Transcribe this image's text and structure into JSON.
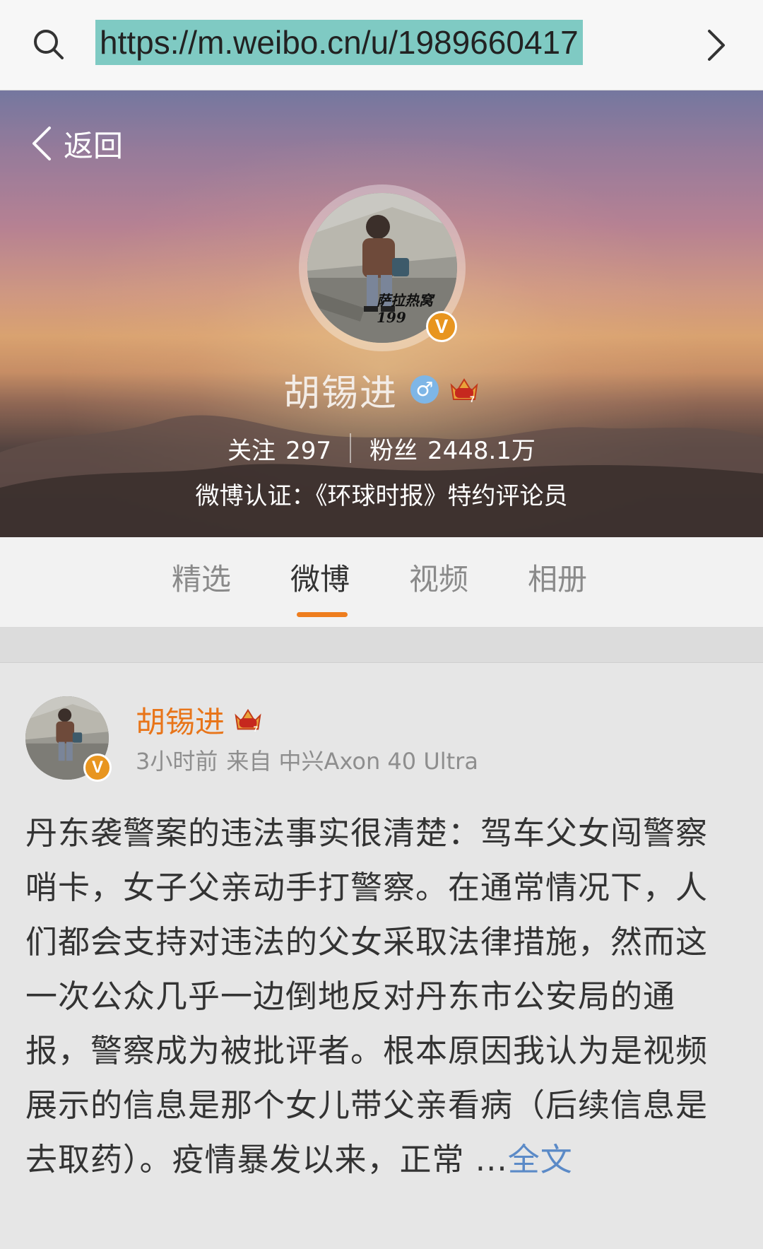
{
  "browser": {
    "url": "https://m.weibo.cn/u/1989660417",
    "search_icon": "search-icon",
    "forward_icon": "chevron-right-icon"
  },
  "header": {
    "back_label": "返回",
    "user_name": "胡锡进",
    "gender_symbol": "♂",
    "avatar_caption": "萨拉热窝 199",
    "verified_badge": "V",
    "follow_label": "关注",
    "follow_count": "297",
    "fans_label": "粉丝",
    "fans_count": "2448.1万",
    "verification": "微博认证：《环球时报》特约评论员"
  },
  "tabs": [
    {
      "label": "精选",
      "active": false
    },
    {
      "label": "微博",
      "active": true
    },
    {
      "label": "视频",
      "active": false
    },
    {
      "label": "相册",
      "active": false
    }
  ],
  "post": {
    "author": "胡锡进",
    "time": "3小时前",
    "source": "来自 中兴Axon 40 Ultra",
    "text": "丹东袭警案的违法事实很清楚：驾车父女闯警察哨卡，女子父亲动手打警察。在通常情况下，人们都会支持对违法的父女采取法律措施，然而这一次公众几乎一边倒地反对丹东市公安局的通报，警察成为被批评者。根本原因我认为是视频展示的信息是那个女儿带父亲看病（后续信息是去取药）。疫情暴发以来，正常 ...",
    "more_label": "全文"
  },
  "colors": {
    "accent": "#ee7d1e",
    "username": "#e8751a",
    "link": "#5b8ac7",
    "url_highlight": "#7fcac3"
  }
}
